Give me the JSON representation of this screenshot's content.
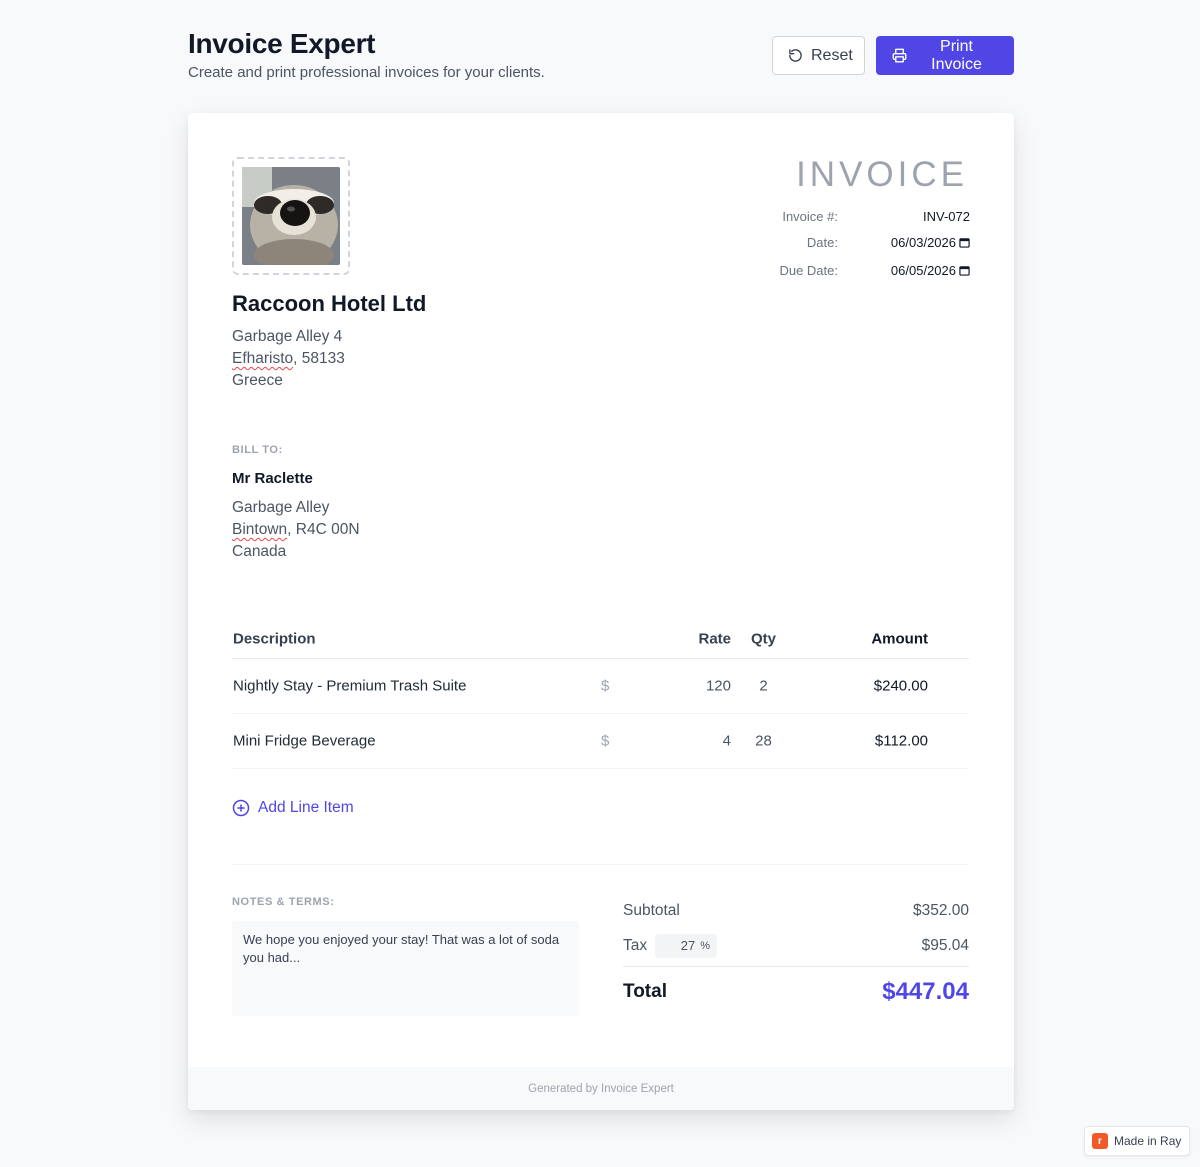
{
  "header": {
    "title": "Invoice Expert",
    "subtitle": "Create and print professional invoices for your clients.",
    "reset_label": "Reset",
    "print_label": "Print Invoice"
  },
  "company": {
    "logo_icon": "raccoon-photo",
    "name": "Raccoon Hotel Ltd",
    "address_line1": "Garbage Alley 4",
    "city": "Efharisto",
    "city_rest": ", 58133",
    "country": "Greece"
  },
  "invoice": {
    "heading": "INVOICE",
    "number_label": "Invoice #:",
    "number": "INV-072",
    "date_label": "Date:",
    "date": "06/03/2026",
    "due_label": "Due Date:",
    "due_date": "06/05/2026"
  },
  "bill_to": {
    "label": "BILL TO:",
    "name": "Mr Raclette",
    "address_line1": "Garbage Alley",
    "city": "Bintown",
    "city_rest": ", R4C 00N",
    "country": "Canada"
  },
  "items": {
    "headers": {
      "description": "Description",
      "rate": "Rate",
      "qty": "Qty",
      "amount": "Amount"
    },
    "rows": [
      {
        "description": "Nightly Stay - Premium Trash Suite",
        "currency": "$",
        "rate": "120",
        "qty": "2",
        "amount": "$240.00"
      },
      {
        "description": "Mini Fridge Beverage",
        "currency": "$",
        "rate": "4",
        "qty": "28",
        "amount": "$112.00"
      }
    ],
    "add_label": "Add Line Item"
  },
  "notes": {
    "label": "NOTES & TERMS:",
    "text": "We hope you enjoyed your stay! That was a lot of soda you had..."
  },
  "totals": {
    "subtotal_label": "Subtotal",
    "subtotal": "$352.00",
    "tax_label": "Tax",
    "tax_rate": "27",
    "tax_unit": "%",
    "tax": "$95.04",
    "total_label": "Total",
    "total": "$447.04"
  },
  "footer": {
    "text": "Generated by Invoice Expert"
  },
  "badge": {
    "text": "Made in Ray",
    "logo_letter": "r"
  },
  "colors": {
    "accent": "#4f46e5",
    "background": "#f8f9fb"
  }
}
